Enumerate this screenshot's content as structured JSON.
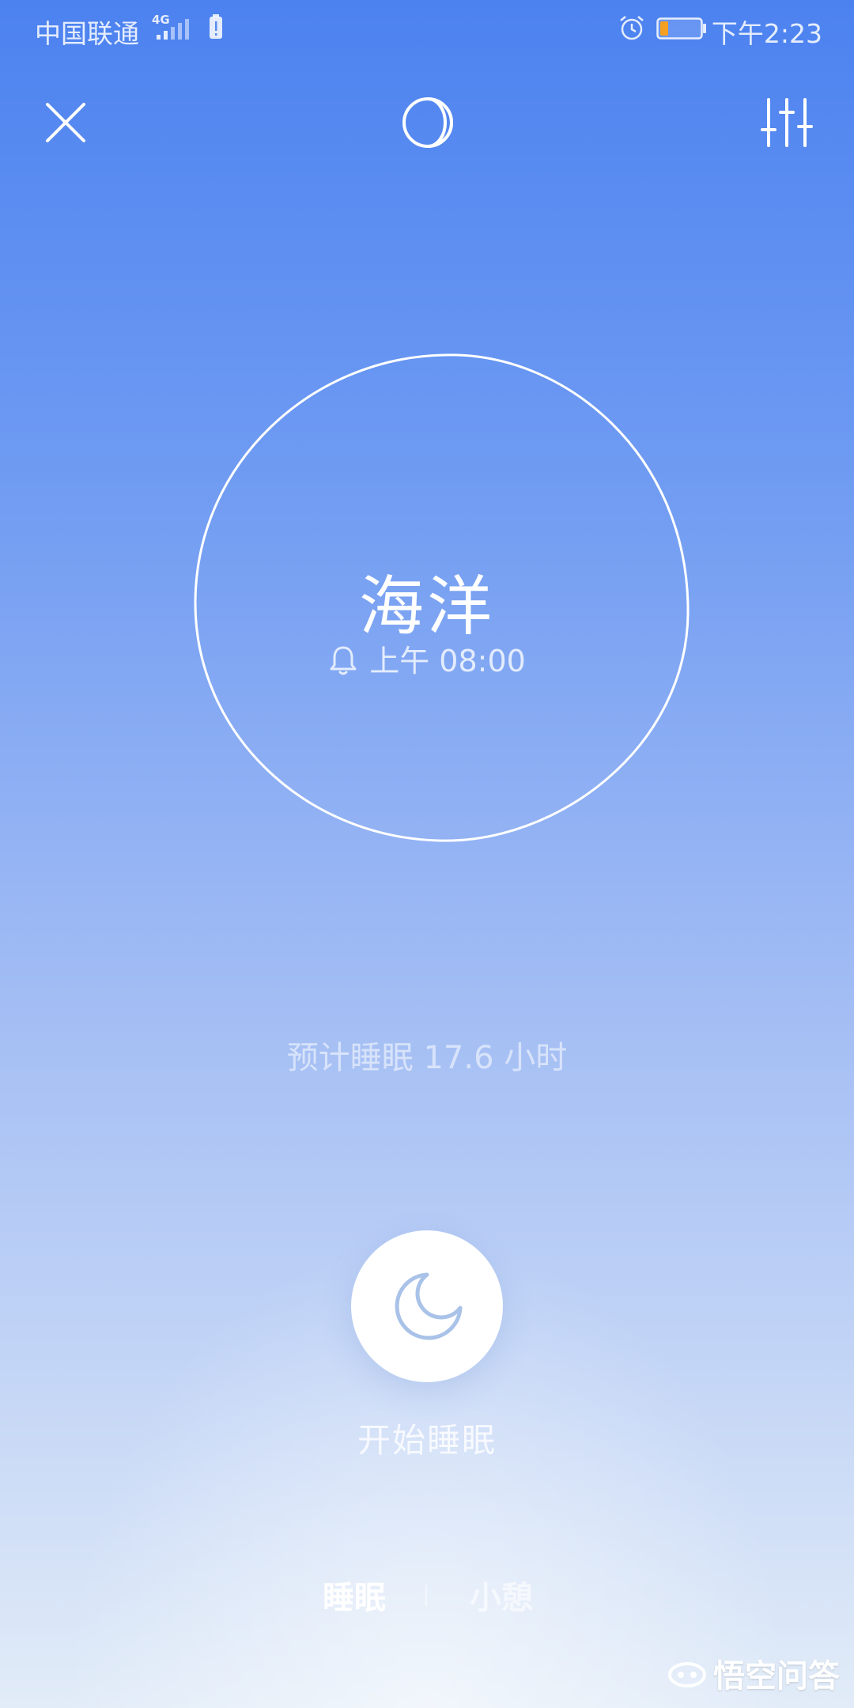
{
  "status_bar": {
    "carrier": "中国联通",
    "network": "4G",
    "time": "下午2:23"
  },
  "toolbar": {
    "close_icon": "close-icon",
    "theme_icon": "moon-phase-icon",
    "settings_icon": "sliders-icon"
  },
  "sound": {
    "title": "海洋",
    "alarm_time": "上午 08:00"
  },
  "estimate": {
    "text": "预计睡眠 17.6 小时"
  },
  "start": {
    "label": "开始睡眠",
    "icon": "crescent-moon-icon"
  },
  "tabs": [
    {
      "label": "睡眠",
      "active": true
    },
    {
      "label": "小憩",
      "active": false
    }
  ],
  "watermark": {
    "text": "悟空问答"
  },
  "colors": {
    "background_top": "#4c82f0",
    "background_bottom": "#e2ecf8",
    "moon_icon": "#a9c2e8",
    "battery_level": "#f5a020"
  }
}
